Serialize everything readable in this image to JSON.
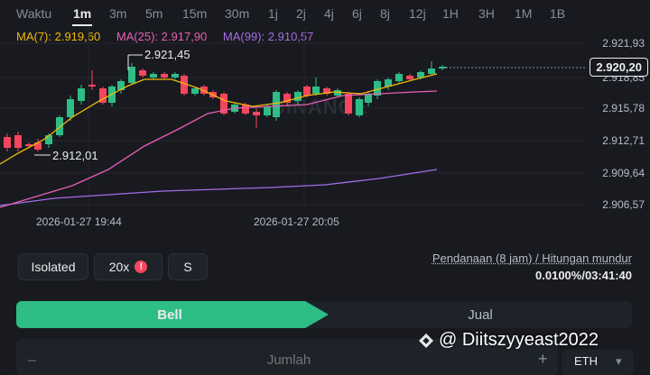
{
  "timeframes": {
    "label": "Waktu",
    "items": [
      "1m",
      "3m",
      "5m",
      "15m",
      "30m",
      "1j",
      "2j",
      "4j",
      "6j",
      "8j",
      "12j",
      "1H",
      "3H",
      "1M",
      "1B"
    ],
    "active": "1m"
  },
  "ma_legend": {
    "ma7": "MA(7): 2.919,60",
    "ma25": "MA(25): 2.917,90",
    "ma99": "MA(99): 2.910,57",
    "colors": {
      "ma7": "#f0b90b",
      "ma25": "#e85fb5",
      "ma99": "#a46de4"
    }
  },
  "chart": {
    "y_ticks": [
      "2.921,93",
      "2.918,85",
      "2.915,78",
      "2.912,71",
      "2.909,64",
      "2.906,57"
    ],
    "x_ticks": [
      "2026-01-27 19:44",
      "2026-01-27 20:05"
    ],
    "current_price": "2.920,20",
    "high_annotation": "2.921,45",
    "low_annotation": "2.912,01",
    "watermark": "BINANCE",
    "colors": {
      "up": "#2ebd85",
      "down": "#f6465d"
    }
  },
  "controls": {
    "margin_mode": "Isolated",
    "leverage": "20x",
    "leverage_alert": "!",
    "asset_mode": "S",
    "funding_label": "Pendanaan (8 jam) / Hitungan mundur",
    "funding_value": "0.0100%/03:41:40"
  },
  "trade": {
    "buy_label": "Bell",
    "sell_label": "Jual",
    "amount_placeholder": "Jumlah",
    "amount_minus": "−",
    "amount_plus": "+",
    "unit": "ETH"
  },
  "credit": "@ Diitszyyeast2022"
}
